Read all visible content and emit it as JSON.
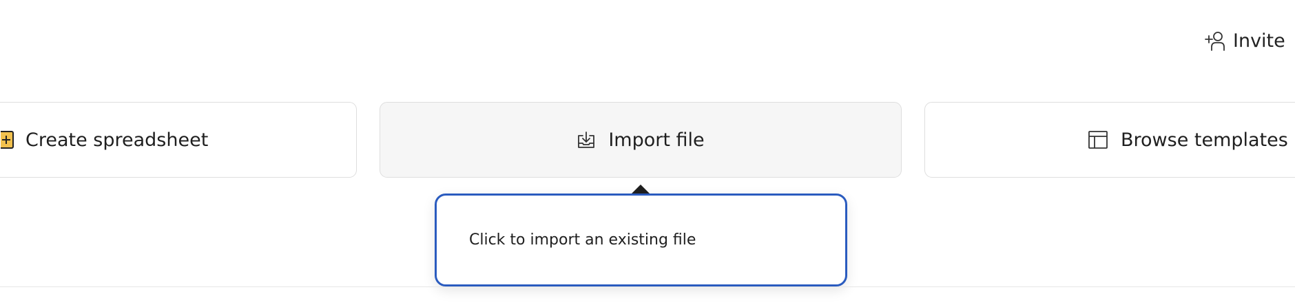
{
  "header": {
    "invite_label": "Invite",
    "invite_icon": "add-user-icon"
  },
  "actions": {
    "create": {
      "label": "Create spreadsheet",
      "icon": "plus-square-icon",
      "icon_color": "#f2c14e"
    },
    "import": {
      "label": "Import file",
      "icon": "download-tray-icon"
    },
    "browse": {
      "label": "Browse templates",
      "icon": "template-layout-icon"
    }
  },
  "tooltip": {
    "text": "Click to import an existing file",
    "border_color": "#2a5bbf"
  }
}
